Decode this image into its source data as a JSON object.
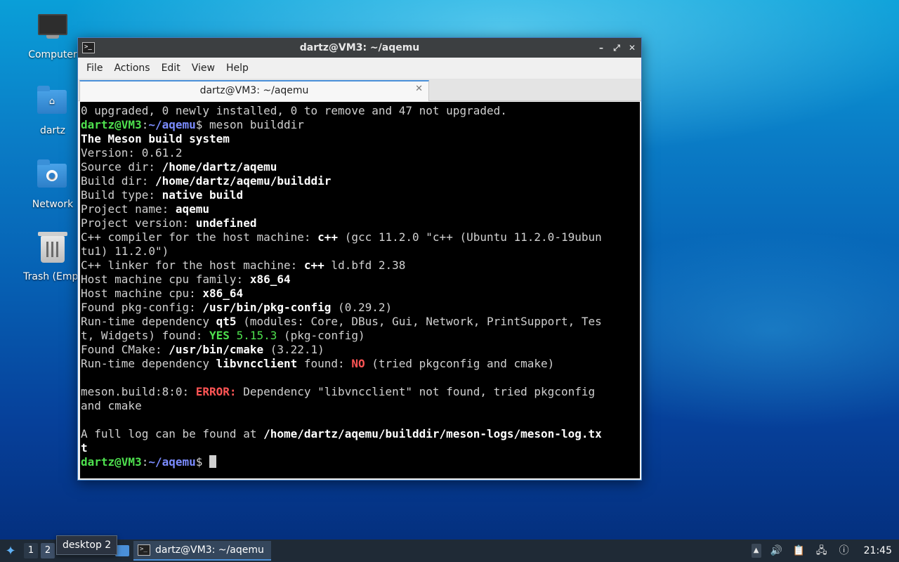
{
  "desktop": {
    "icons": [
      {
        "label": "Computer",
        "icon": "computer-icon"
      },
      {
        "label": "dartz",
        "icon": "home-folder-icon"
      },
      {
        "label": "Network",
        "icon": "network-folder-icon"
      },
      {
        "label": "Trash (Empt",
        "icon": "trash-icon"
      }
    ]
  },
  "window": {
    "title": "dartz@VM3: ~/aqemu",
    "controls": {
      "minimize": "–",
      "maximize": "⤢",
      "close": "✕"
    },
    "menu": [
      "File",
      "Actions",
      "Edit",
      "View",
      "Help"
    ],
    "tab": {
      "label": "dartz@VM3: ~/aqemu",
      "close": "✕"
    }
  },
  "terminal": {
    "l01": "0 upgraded, 0 newly installed, 0 to remove and 47 not upgraded.",
    "prompt_user": "dartz@VM3",
    "prompt_sep": ":",
    "prompt_path": "~/aqemu",
    "prompt_dollar": "$ ",
    "cmd": "meson builddir",
    "l03": "The Meson build system",
    "l04": "Version: 0.61.2",
    "l05_k": "Source dir: ",
    "l05_v": "/home/dartz/aqemu",
    "l06_k": "Build dir: ",
    "l06_v": "/home/dartz/aqemu/builddir",
    "l07_k": "Build type: ",
    "l07_v": "native build",
    "l08_k": "Project name: ",
    "l08_v": "aqemu",
    "l09_k": "Project version: ",
    "l09_v": "undefined",
    "l10_k": "C++ compiler for the host machine: ",
    "l10_v": "c++",
    "l10_r": " (gcc 11.2.0 \"c++ (Ubuntu 11.2.0-19ubun",
    "l11": "tu1) 11.2.0\")",
    "l12_k": "C++ linker for the host machine: ",
    "l12_v": "c++",
    "l12_r": " ld.bfd 2.38",
    "l13_k": "Host machine cpu family: ",
    "l13_v": "x86_64",
    "l14_k": "Host machine cpu: ",
    "l14_v": "x86_64",
    "l15_k": "Found pkg-config: ",
    "l15_v": "/usr/bin/pkg-config",
    "l15_r": " (0.29.2)",
    "l16_k": "Run-time dependency ",
    "l16_v": "qt5",
    "l16_r": " (modules: Core, DBus, Gui, Network, PrintSupport, Tes",
    "l17_k": "t, Widgets) found: ",
    "l17_yes": "YES",
    "l17_ver": " 5.15.3",
    "l17_r": " (pkg-config)",
    "l18_k": "Found CMake: ",
    "l18_v": "/usr/bin/cmake",
    "l18_r": " (3.22.1)",
    "l19_k": "Run-time dependency ",
    "l19_v": "libvncclient",
    "l19_m": " found: ",
    "l19_no": "NO",
    "l19_r": " (tried pkgconfig and cmake)",
    "l21_k": "meson.build:8:0: ",
    "l21_err": "ERROR:",
    "l21_r": " Dependency \"libvncclient\" not found, tried pkgconfig",
    "l22": "and cmake",
    "l24_k": "A full log can be found at ",
    "l24_v": "/home/dartz/aqemu/builddir/meson-logs/meson-log.tx",
    "l25": "t"
  },
  "taskbar": {
    "workspaces": [
      "1",
      "2"
    ],
    "tooltip": "desktop 2",
    "task_label": "dartz@VM3: ~/aqemu",
    "clock": "21:45",
    "tray_icons": [
      "arrow-up-icon",
      "volume-icon",
      "clipboard-icon",
      "network-icon",
      "update-notifier-icon"
    ]
  },
  "colors": {
    "prompt_user": "#4ee04e",
    "prompt_path": "#7b8cff",
    "error": "#ff5555",
    "yes": "#4ee04e",
    "accent": "#4a90d9"
  }
}
